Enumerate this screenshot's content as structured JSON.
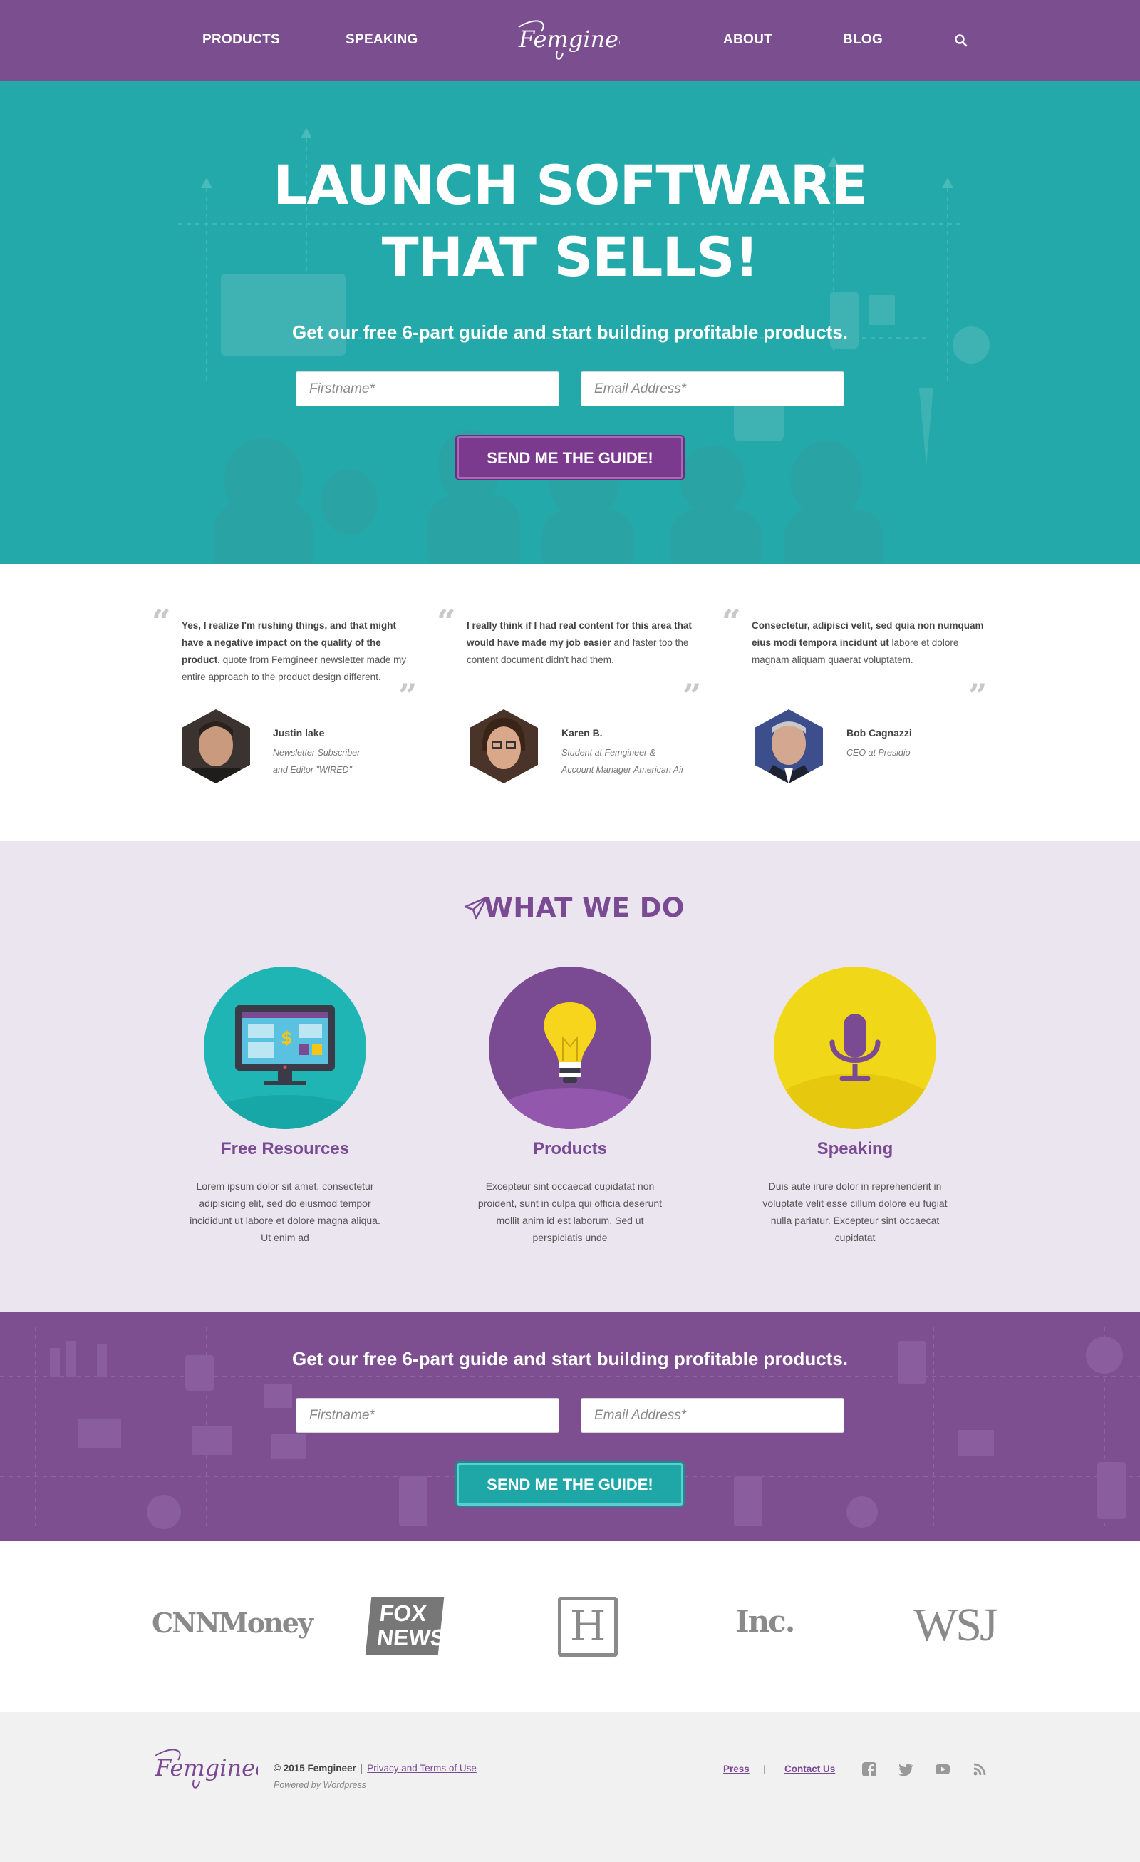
{
  "nav": {
    "products": "PRODUCTS",
    "speaking": "SPEAKING",
    "about": "ABOUT",
    "blog": "BLOG",
    "logo_text": "Femgineer"
  },
  "hero": {
    "title": "LAUNCH SOFTWARE\nTHAT SELLS!",
    "subtitle": "Get our free 6-part guide and start building profitable products.",
    "firstname_placeholder": "Firstname*",
    "email_placeholder": "Email Address*",
    "button": "SEND ME THE GUIDE!"
  },
  "testimonials": [
    {
      "quote_bold": "Yes, I realize I'm rushing things, and that might have a negative impact on the quality of the product.",
      "quote_rest": " quote from Femgineer newsletter made my entire approach to the product design different.",
      "name": "Justin lake",
      "role": "Newsletter Subscriber\nand Editor \"WIRED\""
    },
    {
      "quote_bold": "I really think if I had real content for this area that would have made my job easier",
      "quote_rest": " and faster too the content document didn't had them.",
      "name": "Karen B.",
      "role": "Student at Femgineer &\nAccount Manager American Air"
    },
    {
      "quote_bold": "Consectetur, adipisci velit, sed quia non numquam eius modi tempora incidunt ut",
      "quote_rest": " labore et dolore magnam aliquam quaerat voluptatem.",
      "name": "Bob Cagnazzi",
      "role": "CEO at Presidio"
    }
  ],
  "what_we_do": {
    "title": "WHAT WE DO",
    "services": [
      {
        "title": "Free Resources",
        "text": "Lorem ipsum dolor sit amet, consectetur adipisicing elit, sed do eiusmod tempor incididunt ut labore et dolore magna aliqua. Ut enim ad",
        "icon": "monitor-icon",
        "color": "#1fb5b5"
      },
      {
        "title": "Products",
        "text": "Excepteur sint occaecat cupidatat non proident, sunt in culpa qui officia deserunt mollit anim id est laborum. Sed ut perspiciatis unde",
        "icon": "lightbulb-icon",
        "color": "#7a4a92"
      },
      {
        "title": "Speaking",
        "text": "Duis aute irure dolor in reprehenderit in voluptate velit esse cillum dolore eu fugiat nulla pariatur. Excepteur sint occaecat cupidatat",
        "icon": "microphone-icon",
        "color": "#f0d818"
      }
    ]
  },
  "cta2": {
    "subtitle": "Get our free 6-part guide and start building profitable products.",
    "firstname_placeholder": "Firstname*",
    "email_placeholder": "Email Address*",
    "button": "SEND ME THE GUIDE!"
  },
  "press": {
    "cnn": "CNNMoney",
    "fox_line1": "FOX",
    "fox_line2": "NEWS",
    "huffpost": "H",
    "inc": "Inc.",
    "wsj": "WSJ"
  },
  "footer": {
    "logo_text": "Femgineer",
    "copyright": "© 2015 Femgineer",
    "separator": "|",
    "privacy": "Privacy and Terms of Use",
    "powered": "Powered by Wordpress",
    "press_link": "Press",
    "link_separator": "|",
    "contact": "Contact Us"
  },
  "colors": {
    "purple": "#7b4e90",
    "teal": "#23a9a9",
    "lavender": "#ebe5ef"
  }
}
